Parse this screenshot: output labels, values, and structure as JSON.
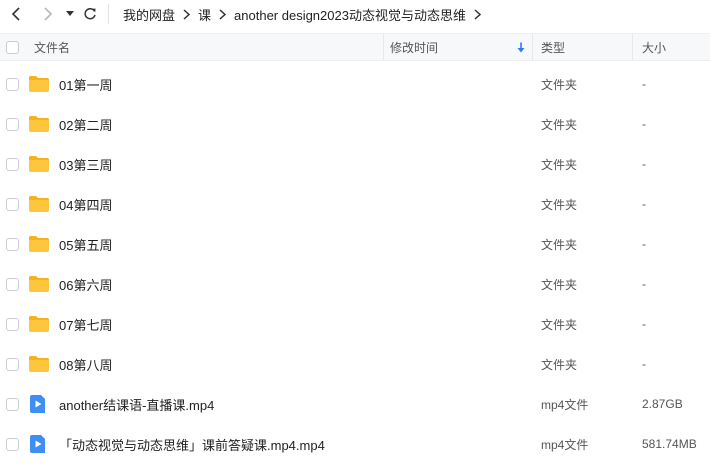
{
  "toolbar": {
    "back_icon": "chevron-left-icon",
    "forward_icon": "chevron-right-icon",
    "history_icon": "caret-down-icon",
    "refresh_icon": "refresh-icon"
  },
  "breadcrumbs": [
    "我的网盘",
    "课",
    "another design2023动态视觉与动态思维"
  ],
  "columns": {
    "name": "文件名",
    "mtime": "修改时间",
    "type": "类型",
    "size": "大小"
  },
  "files": [
    {
      "name": "01第一周",
      "type": "文件夹",
      "size": "-",
      "kind": "folder"
    },
    {
      "name": "02第二周",
      "type": "文件夹",
      "size": "-",
      "kind": "folder"
    },
    {
      "name": "03第三周",
      "type": "文件夹",
      "size": "-",
      "kind": "folder"
    },
    {
      "name": "04第四周",
      "type": "文件夹",
      "size": "-",
      "kind": "folder"
    },
    {
      "name": "05第五周",
      "type": "文件夹",
      "size": "-",
      "kind": "folder"
    },
    {
      "name": "06第六周",
      "type": "文件夹",
      "size": "-",
      "kind": "folder"
    },
    {
      "name": "07第七周",
      "type": "文件夹",
      "size": "-",
      "kind": "folder"
    },
    {
      "name": "08第八周",
      "type": "文件夹",
      "size": "-",
      "kind": "folder"
    },
    {
      "name": "another结课语-直播课.mp4",
      "type": "mp4文件",
      "size": "2.87GB",
      "kind": "video"
    },
    {
      "name": "「动态视觉与动态思维」课前答疑课.mp4.mp4",
      "type": "mp4文件",
      "size": "581.74MB",
      "kind": "video"
    }
  ],
  "colors": {
    "folder": "#ffc53d",
    "folder_tab": "#f5b21f",
    "video": "#3f8ef7",
    "sort_arrow": "#2f7cf6"
  }
}
